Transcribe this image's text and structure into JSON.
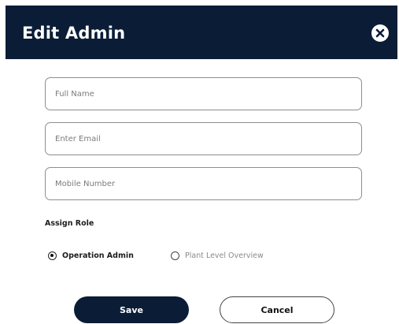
{
  "dialog": {
    "title": "Edit Admin"
  },
  "form": {
    "full_name": {
      "placeholder": "Full Name",
      "value": ""
    },
    "email": {
      "placeholder": "Enter Email",
      "value": ""
    },
    "mobile": {
      "placeholder": "Mobile Number",
      "value": ""
    },
    "role_section_label": "Assign Role",
    "roles": [
      {
        "label": "Operation Admin",
        "selected": true
      },
      {
        "label": "Plant Level Overview",
        "selected": false
      }
    ]
  },
  "actions": {
    "save_label": "Save",
    "cancel_label": "Cancel"
  },
  "icons": {
    "close": "close-circle-icon",
    "radio_selected": "radio-selected-icon",
    "radio_unselected": "radio-unselected-icon"
  },
  "colors": {
    "header_bg": "#0b1c36",
    "primary_button": "#0b1c36",
    "field_border": "#8e8e8e"
  }
}
